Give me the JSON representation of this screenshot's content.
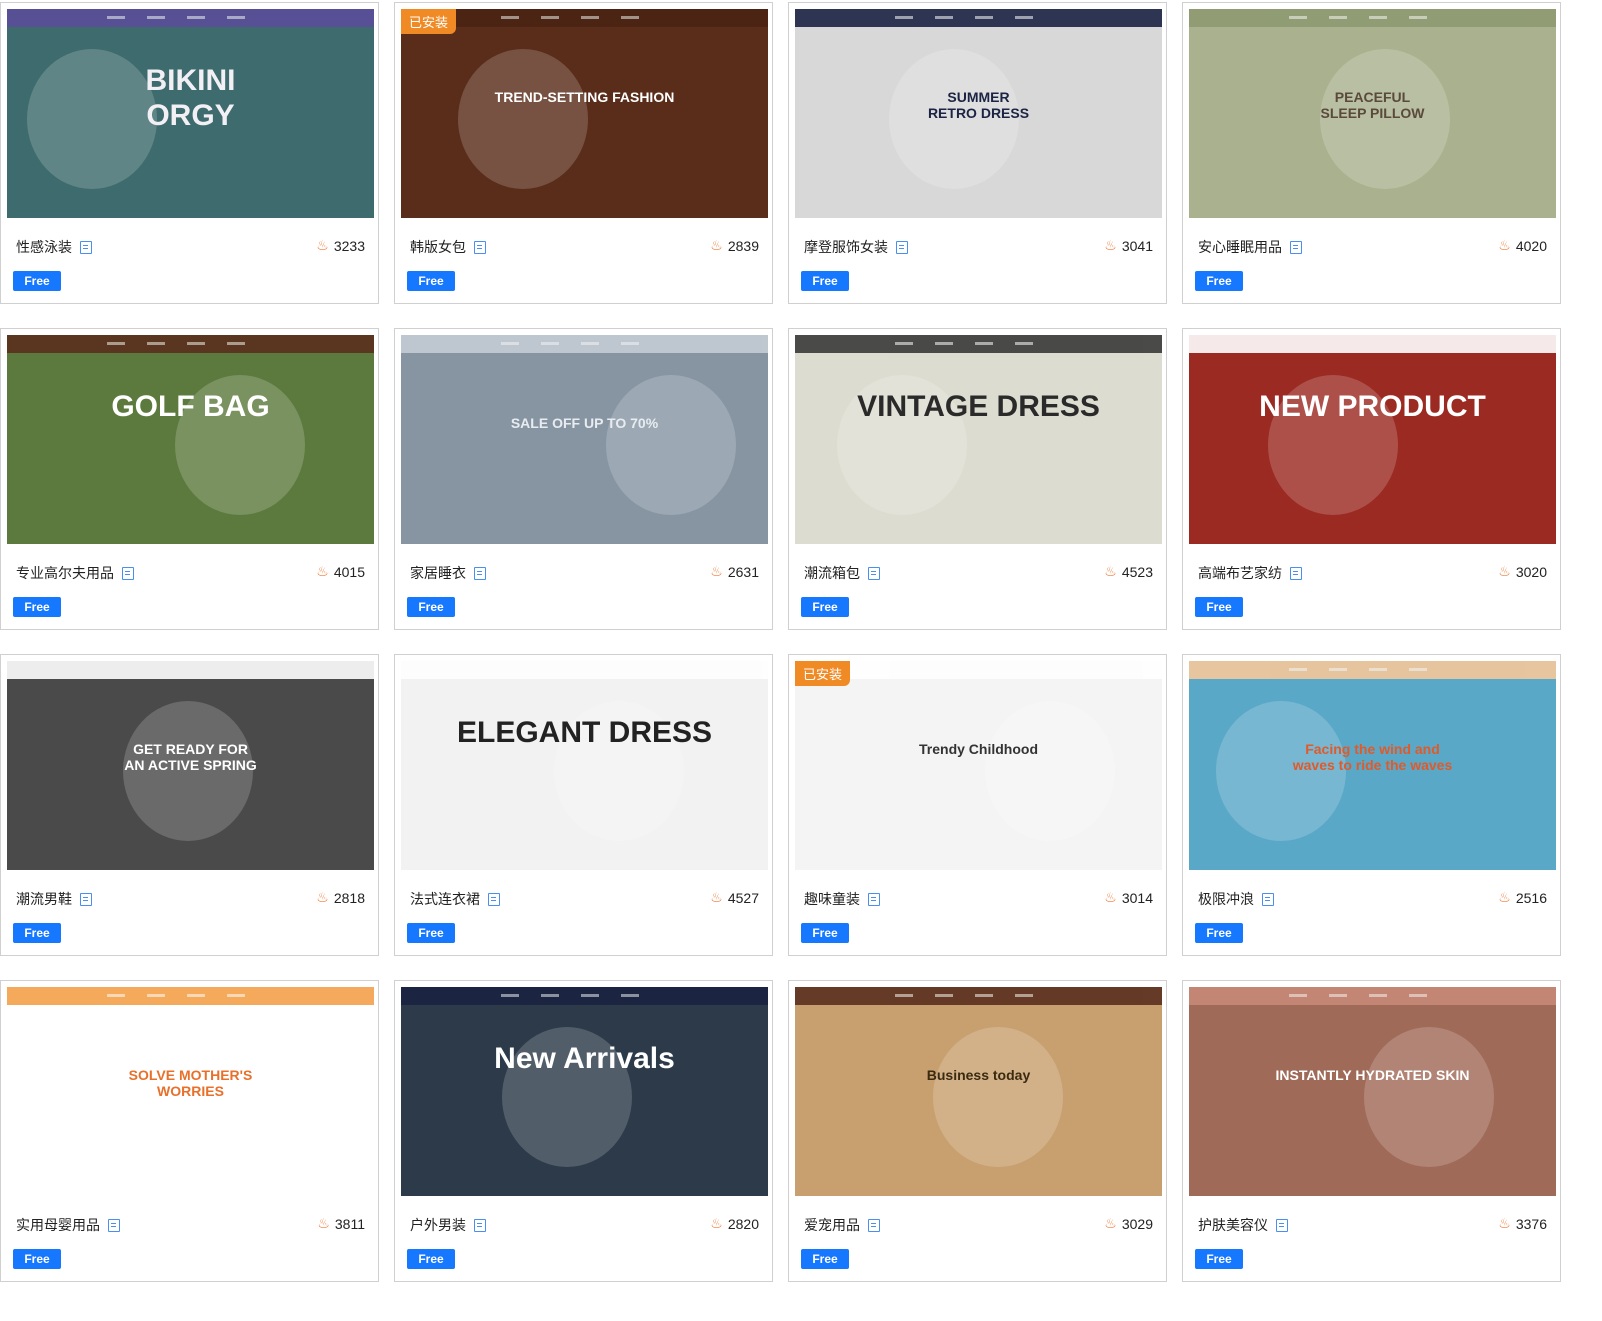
{
  "free_label": "Free",
  "installed_label": "已安装",
  "cards": [
    {
      "name": "性感泳装",
      "count": "3233",
      "headline": "BIKINI\nORGY",
      "bg": "#3e6b6d",
      "nav": "#5a4e9a",
      "fg": "#f2f0f5",
      "installed": false
    },
    {
      "name": "韩版女包",
      "count": "2839",
      "headline": "TREND-SETTING FASHION",
      "bg": "#5a2d1a",
      "nav": "#4b2414",
      "fg": "#ffffff",
      "installed": true
    },
    {
      "name": "摩登服饰女装",
      "count": "3041",
      "headline": "SUMMER\nRETRO DRESS",
      "bg": "#d8d8d8",
      "nav": "#1c2444",
      "fg": "#1c2444",
      "installed": false
    },
    {
      "name": "安心睡眠用品",
      "count": "4020",
      "headline": "PEACEFUL\nSLEEP PILLOW",
      "bg": "#a9b18f",
      "nav": "#8e9a72",
      "fg": "#5a4a3a",
      "installed": false
    },
    {
      "name": "专业高尔夫用品",
      "count": "4015",
      "headline": "GOLF BAG",
      "bg": "#5c7a3e",
      "nav": "#5a2e1c",
      "fg": "#ffffff",
      "installed": false
    },
    {
      "name": "家居睡衣",
      "count": "2631",
      "headline": "SALE OFF UP TO 70%",
      "bg": "#8795a3",
      "nav": "#c5ccd4",
      "fg": "#e8ecf0",
      "installed": false
    },
    {
      "name": "潮流箱包",
      "count": "4523",
      "headline": "VINTAGE DRESS",
      "bg": "#dcdcd0",
      "nav": "#3a3a3a",
      "fg": "#2a2a2a",
      "installed": false
    },
    {
      "name": "高端布艺家纺",
      "count": "3020",
      "headline": "NEW PRODUCT",
      "bg": "#9b2a22",
      "nav": "#ffffff",
      "fg": "#ffffff",
      "installed": false
    },
    {
      "name": "潮流男鞋",
      "count": "2818",
      "headline": "GET READY FOR\nAN ACTIVE SPRING",
      "bg": "#4a4a4a",
      "nav": "#ffffff",
      "fg": "#ffffff",
      "installed": false
    },
    {
      "name": "法式连衣裙",
      "count": "4527",
      "headline": "ELEGANT DRESS",
      "bg": "#f2f2f2",
      "nav": "#ffffff",
      "fg": "#222222",
      "installed": false
    },
    {
      "name": "趣味童装",
      "count": "3014",
      "headline": "Trendy Childhood",
      "bg": "#f4f4f4",
      "nav": "#ffffff",
      "fg": "#333333",
      "installed": true
    },
    {
      "name": "极限冲浪",
      "count": "2516",
      "headline": "Facing the wind and\nwaves to ride the waves",
      "bg": "#5aa8c8",
      "nav": "#f5c89a",
      "fg": "#e05a2a",
      "installed": false
    },
    {
      "name": "实用母婴用品",
      "count": "3811",
      "headline": "SOLVE MOTHER'S\nWORRIES",
      "bg": "#ffffff",
      "nav": "#f4a04a",
      "fg": "#e8702a",
      "installed": false
    },
    {
      "name": "户外男装",
      "count": "2820",
      "headline": "New Arrivals",
      "bg": "#2c3a4a",
      "nav": "#1a2240",
      "fg": "#ffffff",
      "installed": false
    },
    {
      "name": "爱宠用品",
      "count": "3029",
      "headline": "Business today",
      "bg": "#c8a070",
      "nav": "#5a3020",
      "fg": "#3a2a10",
      "installed": false
    },
    {
      "name": "护肤美容仪",
      "count": "3376",
      "headline": "INSTANTLY HYDRATED SKIN",
      "bg": "#a06a58",
      "nav": "#c88a78",
      "fg": "#ffffff",
      "installed": false
    }
  ]
}
